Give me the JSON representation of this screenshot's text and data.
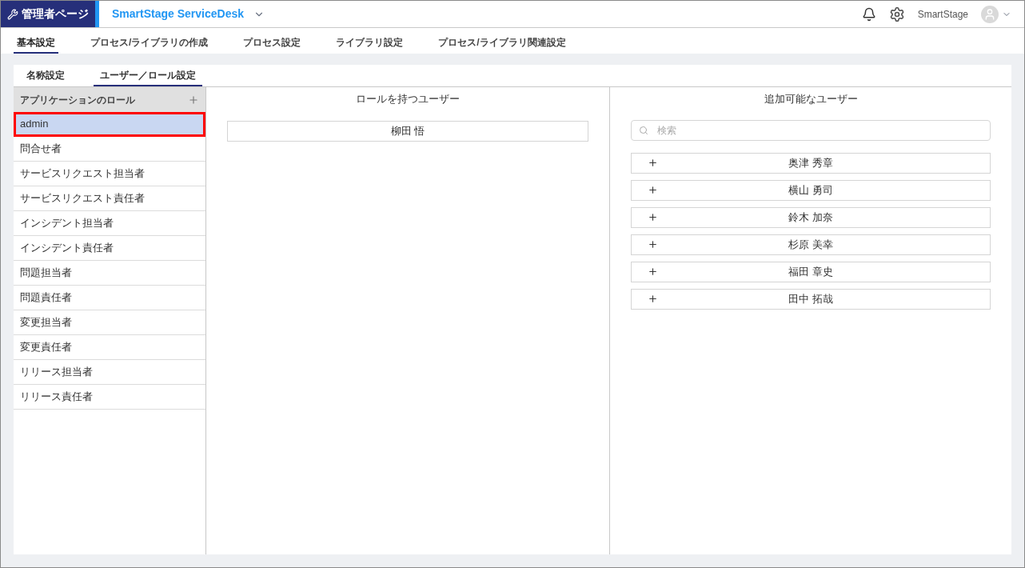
{
  "header": {
    "badge": "管理者ページ",
    "app_name": "SmartStage ServiceDesk",
    "user_name": "SmartStage"
  },
  "main_tabs": [
    {
      "label": "基本設定",
      "selected": true
    },
    {
      "label": "プロセス/ライブラリの作成",
      "selected": false
    },
    {
      "label": "プロセス設定",
      "selected": false
    },
    {
      "label": "ライブラリ設定",
      "selected": false
    },
    {
      "label": "プロセス/ライブラリ関連設定",
      "selected": false
    }
  ],
  "sub_tabs": [
    {
      "label": "名称設定",
      "selected": false
    },
    {
      "label": "ユーザー／ロール設定",
      "selected": true
    }
  ],
  "roles_panel": {
    "title": "アプリケーションのロール",
    "items": [
      {
        "label": "admin",
        "selected": true,
        "annotated": true
      },
      {
        "label": "問合せ者",
        "selected": false,
        "annotated": false
      },
      {
        "label": "サービスリクエスト担当者",
        "selected": false,
        "annotated": false
      },
      {
        "label": "サービスリクエスト責任者",
        "selected": false,
        "annotated": false
      },
      {
        "label": "インシデント担当者",
        "selected": false,
        "annotated": false
      },
      {
        "label": "インシデント責任者",
        "selected": false,
        "annotated": false
      },
      {
        "label": "問題担当者",
        "selected": false,
        "annotated": false
      },
      {
        "label": "問題責任者",
        "selected": false,
        "annotated": false
      },
      {
        "label": "変更担当者",
        "selected": false,
        "annotated": false
      },
      {
        "label": "変更責任者",
        "selected": false,
        "annotated": false
      },
      {
        "label": "リリース担当者",
        "selected": false,
        "annotated": false
      },
      {
        "label": "リリース責任者",
        "selected": false,
        "annotated": false
      }
    ]
  },
  "role_users": {
    "title": "ロールを持つユーザー",
    "users": [
      "柳田 悟"
    ]
  },
  "available_users": {
    "title": "追加可能なユーザー",
    "search": {
      "placeholder": "検索"
    },
    "users": [
      "奥津 秀章",
      "横山 勇司",
      "鈴木 加奈",
      "杉原 美幸",
      "福田 章史",
      "田中 拓哉"
    ]
  }
}
